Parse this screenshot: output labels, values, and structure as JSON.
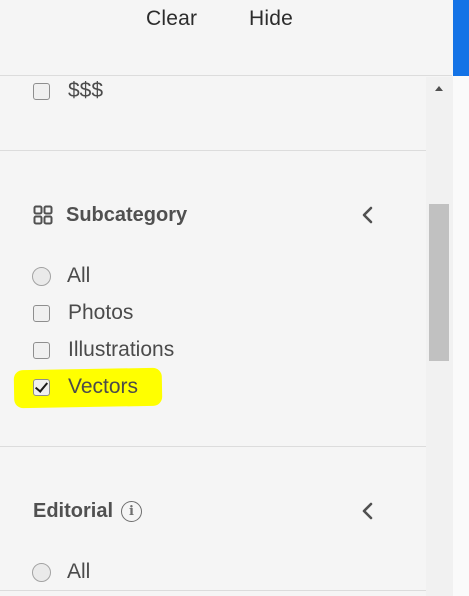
{
  "header": {
    "clear_label": "Clear",
    "hide_label": "Hide"
  },
  "price_filter": {
    "partial_option": "$$$"
  },
  "subcategory": {
    "title": "Subcategory",
    "options": [
      {
        "label": "All",
        "type": "radio",
        "selected": false
      },
      {
        "label": "Photos",
        "type": "checkbox",
        "checked": false
      },
      {
        "label": "Illustrations",
        "type": "checkbox",
        "checked": false
      },
      {
        "label": "Vectors",
        "type": "checkbox",
        "checked": true
      }
    ]
  },
  "editorial": {
    "title": "Editorial",
    "info_glyph": "i",
    "options": [
      {
        "label": "All",
        "type": "radio",
        "selected": false
      }
    ]
  },
  "colors": {
    "accent": "#1473e6",
    "highlight": "#ffff00"
  },
  "icons": {
    "subcategory": "grid-icon",
    "collapse": "chevron-left-icon",
    "info": "info-icon"
  }
}
